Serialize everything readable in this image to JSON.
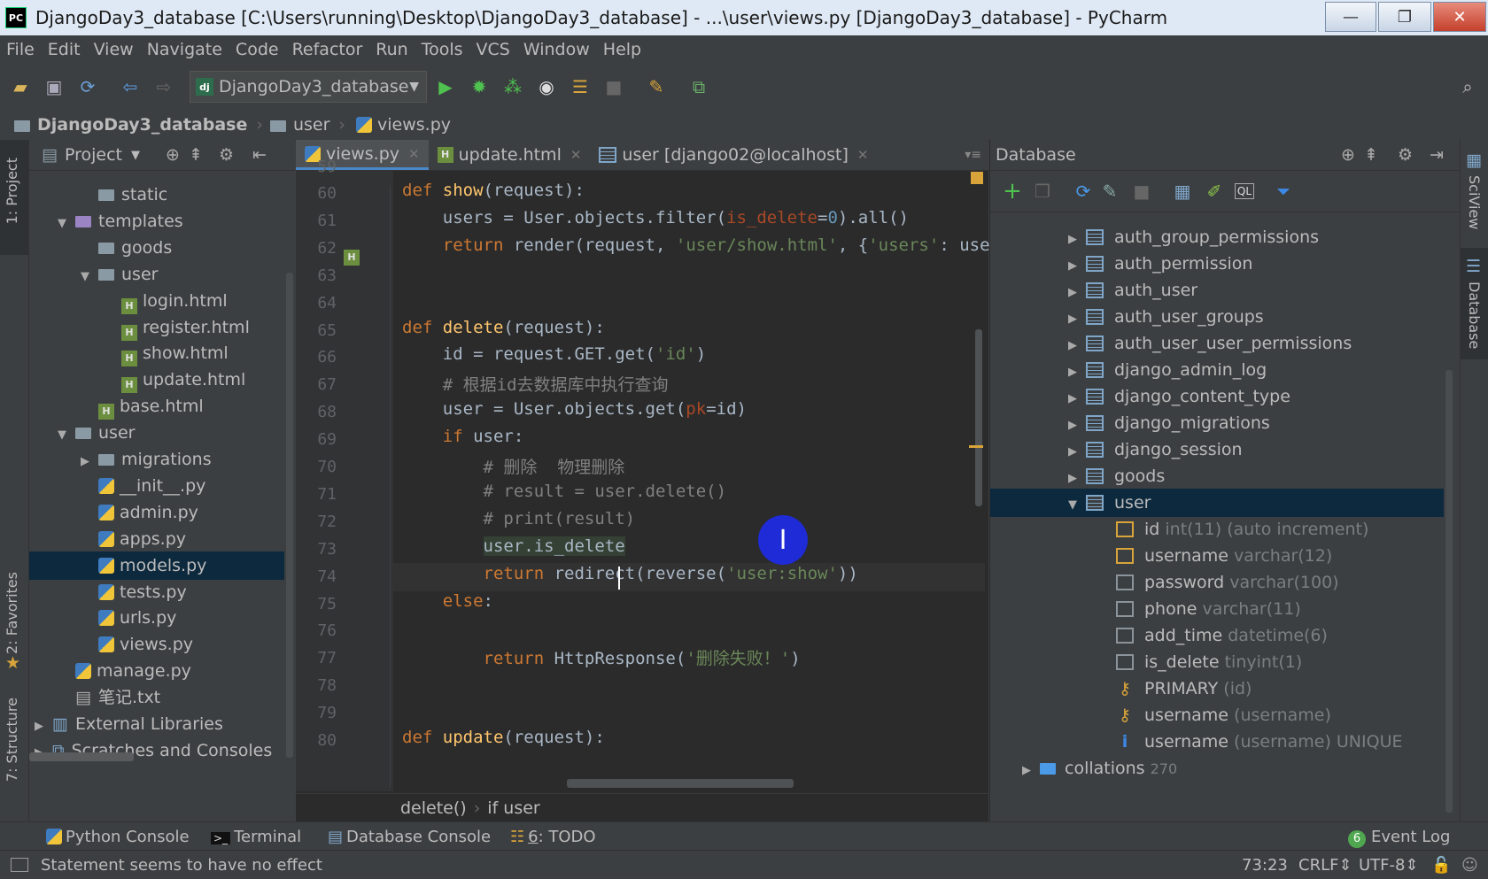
{
  "window": {
    "title": "DjangoDay3_database [C:\\Users\\running\\Desktop\\DjangoDay3_database] - ...\\user\\views.py [DjangoDay3_database] - PyCharm",
    "app_badge": "PC",
    "minimize": "—",
    "restore": "❐",
    "close": "✕"
  },
  "menu": [
    "File",
    "Edit",
    "View",
    "Navigate",
    "Code",
    "Refactor",
    "Run",
    "Tools",
    "VCS",
    "Window",
    "Help"
  ],
  "toolbar": {
    "run_config": "DjangoDay3_database",
    "run_config_badge": "dj"
  },
  "breadcrumb": [
    "DjangoDay3_database",
    "user",
    "views.py"
  ],
  "left_stripe": {
    "project": "1: Project",
    "favorites": "2: Favorites",
    "structure": "7: Structure"
  },
  "right_stripe": {
    "sciview": "SciView",
    "database": "Database"
  },
  "project_panel": {
    "title": "Project",
    "items": [
      {
        "label": "static",
        "depth": 2,
        "icon": "folder",
        "arrow": ""
      },
      {
        "label": "templates",
        "depth": 1,
        "icon": "folder",
        "arrow": "▼"
      },
      {
        "label": "goods",
        "depth": 2,
        "icon": "folder",
        "arrow": ""
      },
      {
        "label": "user",
        "depth": 2,
        "icon": "folder",
        "arrow": "▼"
      },
      {
        "label": "login.html",
        "depth": 3,
        "icon": "html",
        "arrow": ""
      },
      {
        "label": "register.html",
        "depth": 3,
        "icon": "html",
        "arrow": ""
      },
      {
        "label": "show.html",
        "depth": 3,
        "icon": "html",
        "arrow": ""
      },
      {
        "label": "update.html",
        "depth": 3,
        "icon": "html",
        "arrow": ""
      },
      {
        "label": "base.html",
        "depth": 2,
        "icon": "html",
        "arrow": ""
      },
      {
        "label": "user",
        "depth": 1,
        "icon": "folder",
        "arrow": "▼"
      },
      {
        "label": "migrations",
        "depth": 2,
        "icon": "folder",
        "arrow": "▶"
      },
      {
        "label": "__init__.py",
        "depth": 2,
        "icon": "py",
        "arrow": ""
      },
      {
        "label": "admin.py",
        "depth": 2,
        "icon": "py",
        "arrow": ""
      },
      {
        "label": "apps.py",
        "depth": 2,
        "icon": "py",
        "arrow": ""
      },
      {
        "label": "models.py",
        "depth": 2,
        "icon": "py",
        "arrow": "",
        "selected": true
      },
      {
        "label": "tests.py",
        "depth": 2,
        "icon": "py",
        "arrow": ""
      },
      {
        "label": "urls.py",
        "depth": 2,
        "icon": "py",
        "arrow": ""
      },
      {
        "label": "views.py",
        "depth": 2,
        "icon": "py",
        "arrow": ""
      },
      {
        "label": "manage.py",
        "depth": 1,
        "icon": "py",
        "arrow": ""
      },
      {
        "label": "笔记.txt",
        "depth": 1,
        "icon": "txt",
        "arrow": ""
      },
      {
        "label": "External Libraries",
        "depth": 0,
        "icon": "lib",
        "arrow": "▶"
      },
      {
        "label": "Scratches and Consoles",
        "depth": 0,
        "icon": "scratch",
        "arrow": "▶"
      }
    ]
  },
  "editor": {
    "tabs": [
      {
        "label": "views.py",
        "active": true
      },
      {
        "label": "update.html",
        "active": false
      },
      {
        "label": "user [django02@localhost]",
        "active": false
      }
    ],
    "lines": [
      {
        "n": "60",
        "html": "<span class=\"kw\">def </span><span class=\"fn\">show</span>(request):"
      },
      {
        "n": "61",
        "html": "    users = User.objects.filter(<span class=\"param\">is_delete</span>=<span class=\"num\">0</span>).all()"
      },
      {
        "n": "62",
        "html": "    <span class=\"kw\">return </span>render(request, <span class=\"str\">'user/show.html'</span>, {<span class=\"str\">'users'</span>: users"
      },
      {
        "n": "63",
        "html": ""
      },
      {
        "n": "64",
        "html": ""
      },
      {
        "n": "65",
        "html": "<span class=\"kw\">def </span><span class=\"fn\">delete</span>(request):"
      },
      {
        "n": "66",
        "html": "    id = request.GET.get(<span class=\"str\">'id'</span>)"
      },
      {
        "n": "67",
        "html": "    <span class=\"cmt\"># 根据id去数据库中执行查询</span>"
      },
      {
        "n": "68",
        "html": "    user = User.objects.get(<span class=\"param\">pk</span>=id)"
      },
      {
        "n": "69",
        "html": "    <span class=\"kw\">if </span>user:"
      },
      {
        "n": "70",
        "html": "        <span class=\"cmt\"># 删除  物理删除</span>"
      },
      {
        "n": "71",
        "html": "        <span class=\"cmt\"># result = user.delete()</span>"
      },
      {
        "n": "72",
        "html": "        <span class=\"cmt\"># print(result)</span>"
      },
      {
        "n": "73",
        "html": "        <span class=\"hl\">user.is_delete</span>"
      },
      {
        "n": "74",
        "html": "        <span class=\"kw\">return </span>redirect(reverse(<span class=\"str\">'user:show'</span>))"
      },
      {
        "n": "75",
        "html": "    <span class=\"kw\">else</span>:"
      },
      {
        "n": "76",
        "html": ""
      },
      {
        "n": "77",
        "html": "        <span class=\"kw\">return </span>HttpResponse(<span class=\"str\">'删除失败！'</span>)"
      },
      {
        "n": "78",
        "html": ""
      },
      {
        "n": "79",
        "html": ""
      },
      {
        "n": "80",
        "html": "<span class=\"kw\">def </span><span class=\"fn\">update</span>(request):"
      }
    ],
    "first_line_partial": "59",
    "crumb": [
      "delete()",
      "if user"
    ]
  },
  "database_panel": {
    "title": "Database",
    "tables": [
      {
        "label": "auth_group_permissions"
      },
      {
        "label": "auth_permission"
      },
      {
        "label": "auth_user"
      },
      {
        "label": "auth_user_groups"
      },
      {
        "label": "auth_user_user_permissions"
      },
      {
        "label": "django_admin_log"
      },
      {
        "label": "django_content_type"
      },
      {
        "label": "django_migrations"
      },
      {
        "label": "django_session"
      },
      {
        "label": "goods"
      }
    ],
    "user_table": "user",
    "columns": [
      {
        "name": "id",
        "type": "int(11) (auto increment)",
        "icon": "pk"
      },
      {
        "name": "username",
        "type": "varchar(12)",
        "icon": "idx"
      },
      {
        "name": "password",
        "type": "varchar(100)",
        "icon": "col"
      },
      {
        "name": "phone",
        "type": "varchar(11)",
        "icon": "col"
      },
      {
        "name": "add_time",
        "type": "datetime(6)",
        "icon": "col"
      },
      {
        "name": "is_delete",
        "type": "tinyint(1)",
        "icon": "col"
      },
      {
        "name": "PRIMARY",
        "type": "(id)",
        "icon": "key"
      },
      {
        "name": "username",
        "type": "(username)",
        "icon": "key"
      },
      {
        "name": "username",
        "type": "(username) UNIQUE",
        "icon": "info"
      }
    ],
    "collations": {
      "label": "collations",
      "count": "270"
    }
  },
  "bottom_tabs": {
    "python_console": "Python Console",
    "terminal": "Terminal",
    "database_console": "Database Console",
    "todo_num": "6",
    "todo": ": TODO",
    "event_log_badge": "6",
    "event_log": "Event Log"
  },
  "status": {
    "message": "Statement seems to have no effect",
    "position": "73:23",
    "line_sep": "CRLF⇕",
    "encoding": "UTF-8⇕"
  },
  "cursor_glyph": "I"
}
